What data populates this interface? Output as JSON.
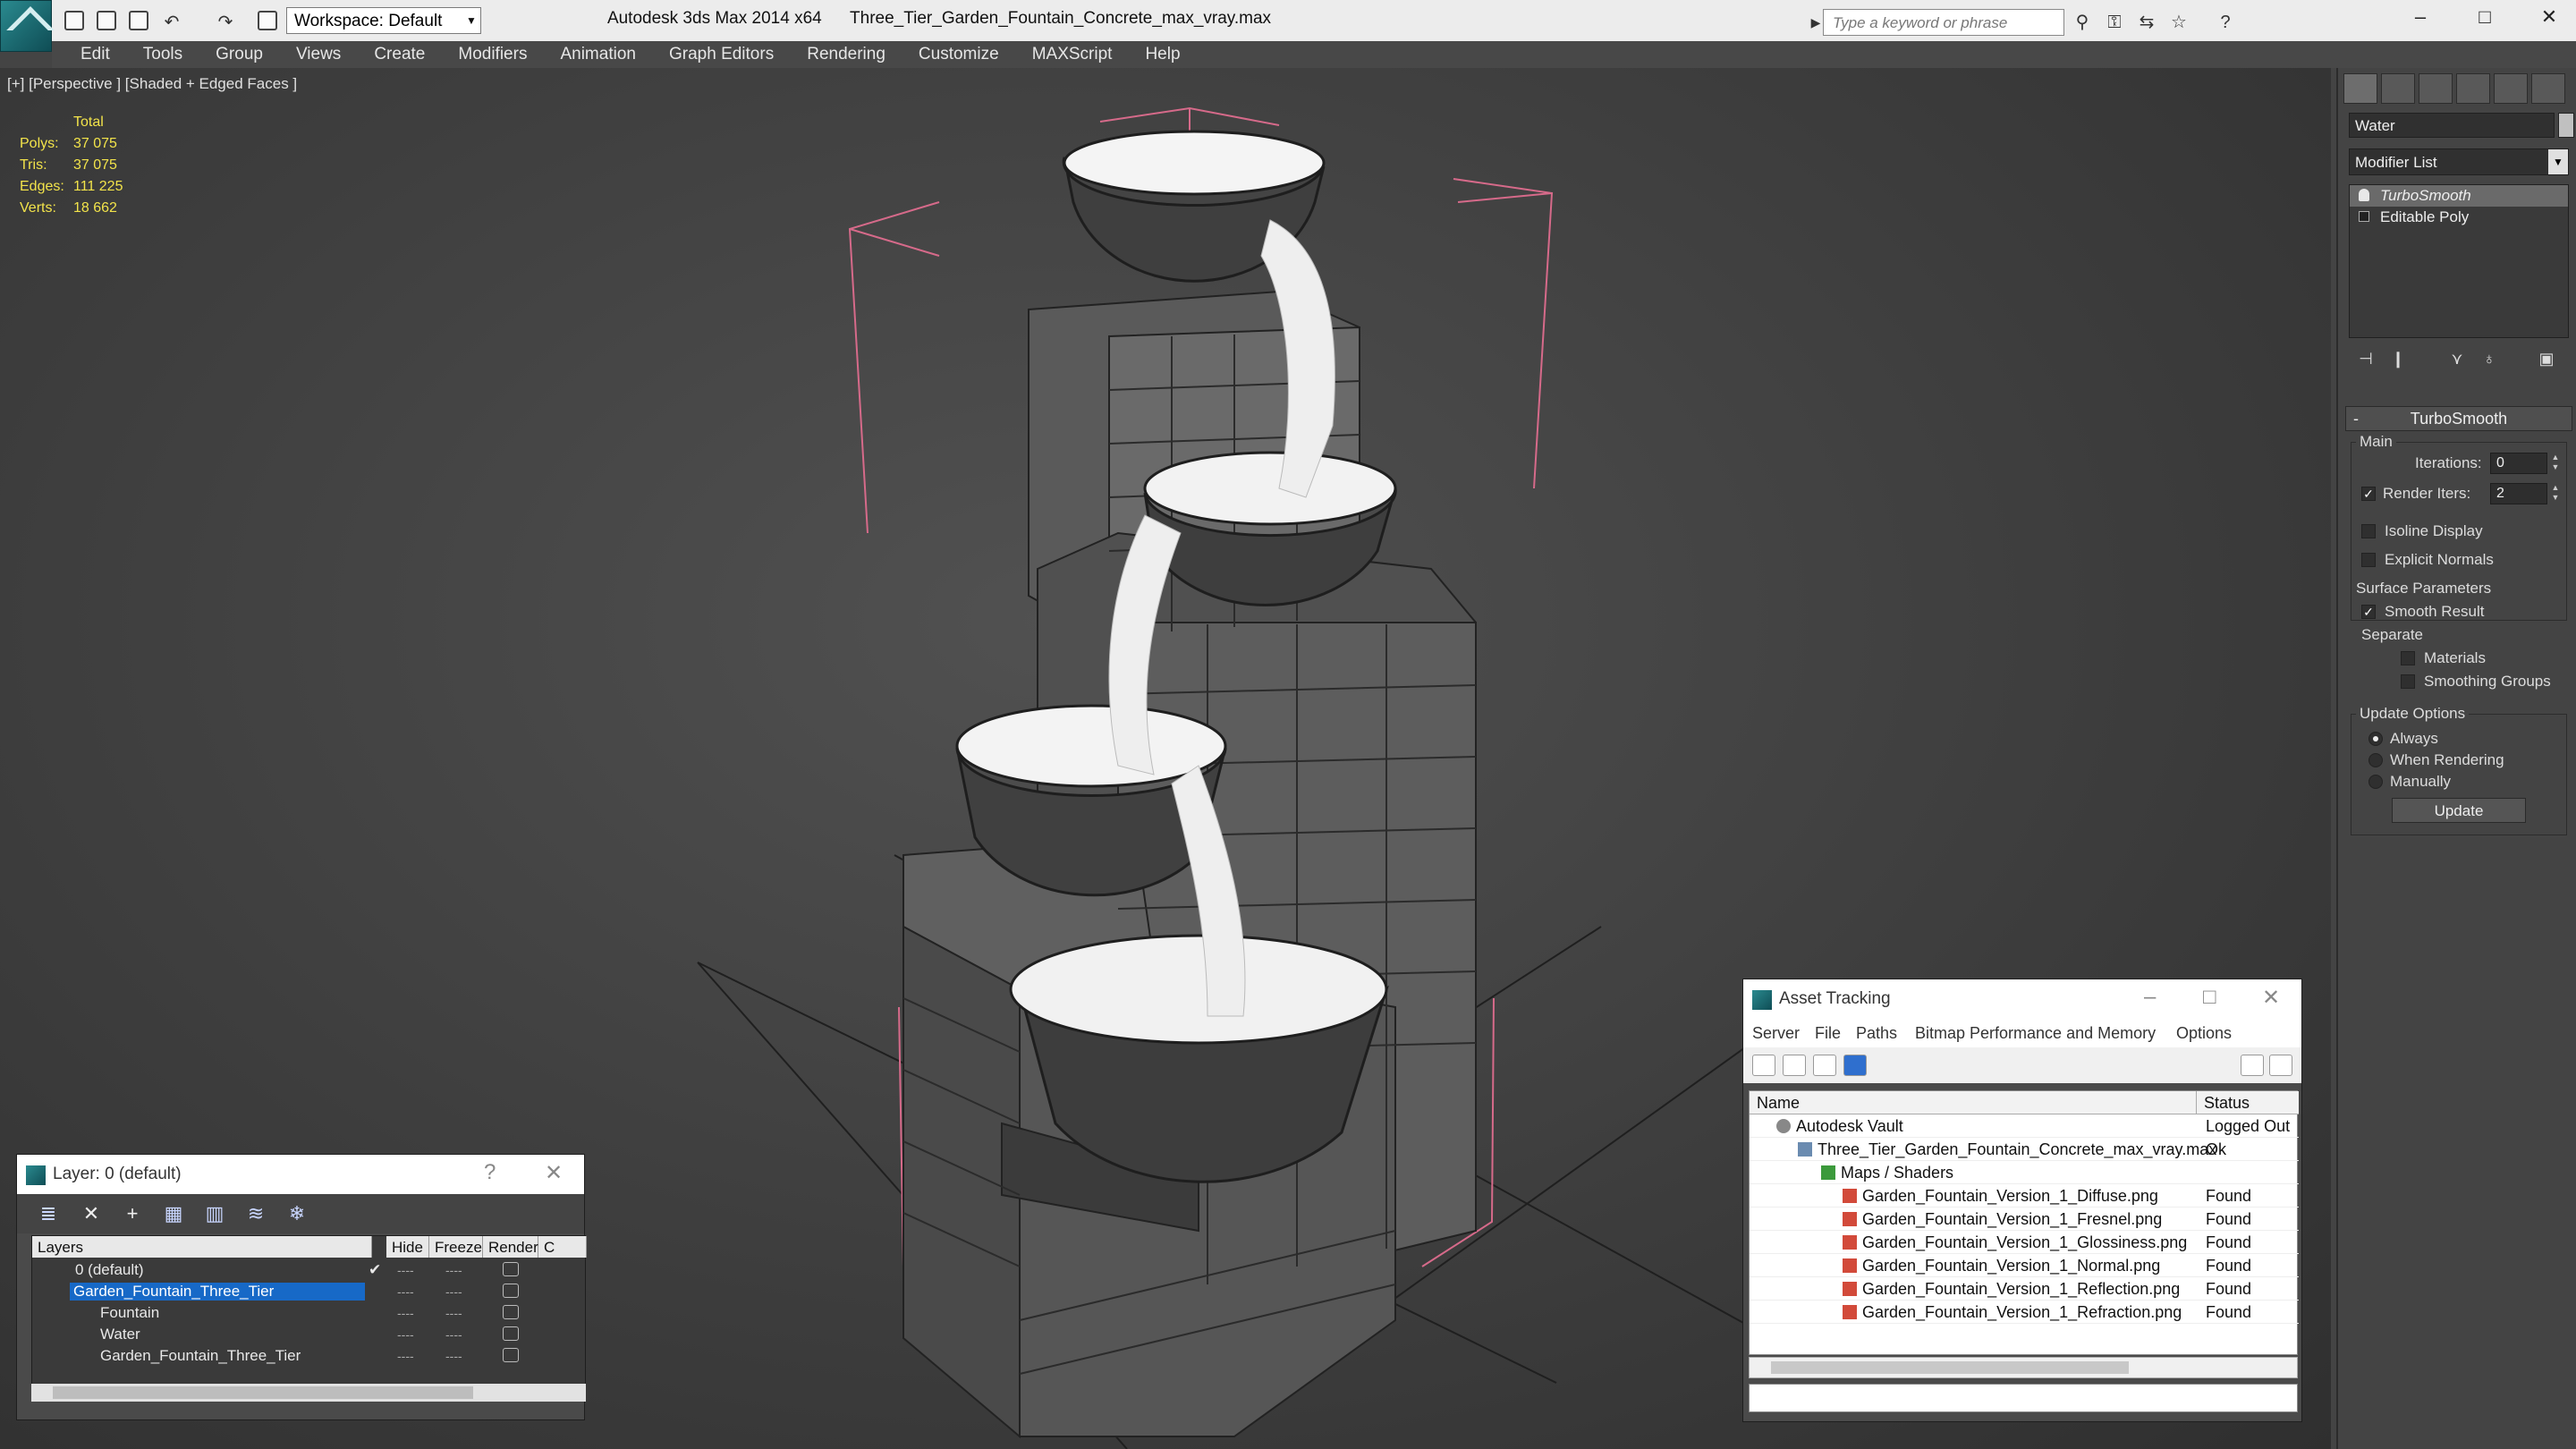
{
  "titlebar": {
    "app_title": "Autodesk 3ds Max  2014 x64",
    "file_title": "Three_Tier_Garden_Fountain_Concrete_max_vray.max",
    "workspace": "Workspace: Default",
    "search_placeholder": "Type a keyword or phrase",
    "window_buttons": [
      "–",
      "□",
      "✕"
    ]
  },
  "menubar": {
    "items": [
      "Edit",
      "Tools",
      "Group",
      "Views",
      "Create",
      "Modifiers",
      "Animation",
      "Graph Editors",
      "Rendering",
      "Customize",
      "MAXScript",
      "Help"
    ]
  },
  "viewport": {
    "label": "[+] [Perspective ] [Shaded + Edged Faces ]",
    "stats": {
      "header": "Total",
      "rows": [
        {
          "key": "Polys:",
          "value": "37 075"
        },
        {
          "key": "Tris:",
          "value": "37 075"
        },
        {
          "key": "Edges:",
          "value": "111 225"
        },
        {
          "key": "Verts:",
          "value": "18 662"
        }
      ],
      "color": "#f2e34a"
    }
  },
  "command_panel": {
    "object_name": "Water",
    "modifier_list_label": "Modifier List",
    "stack": [
      "TurboSmooth",
      "Editable Poly"
    ],
    "rollout_title": "TurboSmooth",
    "main_group": "Main",
    "iterations_label": "Iterations:",
    "iterations_value": "0",
    "render_iters_label": "Render Iters:",
    "render_iters_value": "2",
    "render_iters_checked": true,
    "isoline_label": "Isoline Display",
    "explicit_normals_label": "Explicit Normals",
    "surface_group": "Surface Parameters",
    "smooth_result_label": "Smooth Result",
    "separate_label": "Separate",
    "materials_label": "Materials",
    "smoothing_groups_label": "Smoothing Groups",
    "update_group": "Update Options",
    "always_label": "Always",
    "when_rendering_label": "When Rendering",
    "manually_label": "Manually",
    "update_button": "Update"
  },
  "layer_window": {
    "title": "Layer: 0 (default)",
    "help": "?",
    "close": "✕",
    "columns": [
      "Layers",
      "Hide",
      "Freeze",
      "Render",
      "C"
    ],
    "rows": [
      {
        "name": "0 (default)",
        "indent": 1,
        "selected": false
      },
      {
        "name": "Garden_Fountain_Three_Tier",
        "indent": 1,
        "selected": true
      },
      {
        "name": "Fountain",
        "indent": 2,
        "selected": false
      },
      {
        "name": "Water",
        "indent": 2,
        "selected": false
      },
      {
        "name": "Garden_Fountain_Three_Tier",
        "indent": 2,
        "selected": false
      }
    ],
    "dash": "----"
  },
  "asset_window": {
    "title": "Asset Tracking",
    "menu": [
      "Server",
      "File",
      "Paths",
      "Bitmap Performance and Memory",
      "Options"
    ],
    "columns": [
      "Name",
      "Status"
    ],
    "rows": [
      {
        "name": "Autodesk Vault",
        "status": "Logged Out",
        "indent": 1
      },
      {
        "name": "Three_Tier_Garden_Fountain_Concrete_max_vray.max",
        "status": "Ok",
        "indent": 2
      },
      {
        "name": "Maps / Shaders",
        "status": "",
        "indent": 3
      },
      {
        "name": "Garden_Fountain_Version_1_Diffuse.png",
        "status": "Found",
        "indent": 4
      },
      {
        "name": "Garden_Fountain_Version_1_Fresnel.png",
        "status": "Found",
        "indent": 4
      },
      {
        "name": "Garden_Fountain_Version_1_Glossiness.png",
        "status": "Found",
        "indent": 4
      },
      {
        "name": "Garden_Fountain_Version_1_Normal.png",
        "status": "Found",
        "indent": 4
      },
      {
        "name": "Garden_Fountain_Version_1_Reflection.png",
        "status": "Found",
        "indent": 4
      },
      {
        "name": "Garden_Fountain_Version_1_Refraction.png",
        "status": "Found",
        "indent": 4
      }
    ]
  }
}
